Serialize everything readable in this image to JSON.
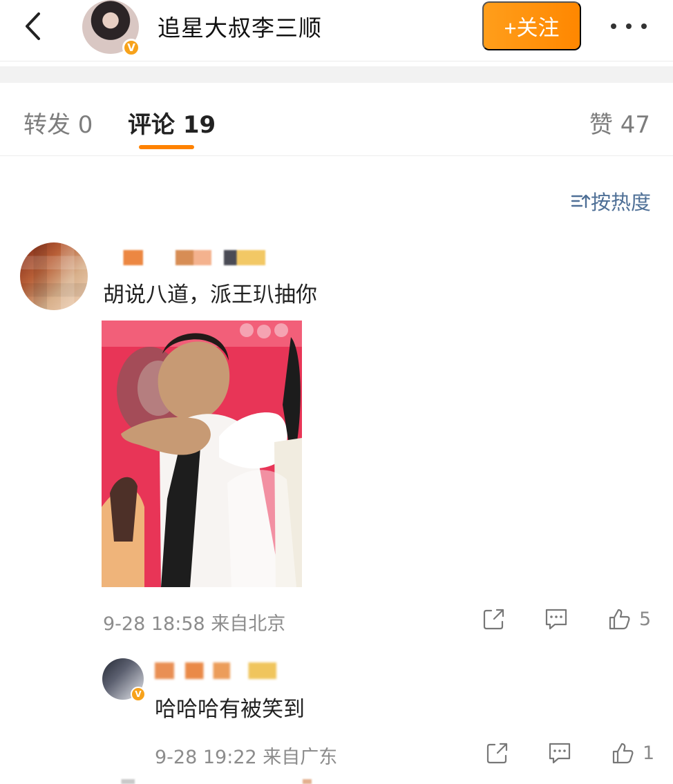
{
  "header": {
    "title": "追星大叔李三顺",
    "follow_label": "+关注",
    "avatar_badge": "V"
  },
  "tabs": {
    "repost": "转发 0",
    "comments": "评论 19",
    "likes": "赞 47"
  },
  "sort": {
    "label": "按热度"
  },
  "comment": {
    "text": "胡说八道，派王玐抽你",
    "meta": "9-28 18:58 来自北京",
    "likes": "5"
  },
  "reply": {
    "text": "哈哈哈有被笑到",
    "meta": "9-28 19:22 来自广东",
    "likes": "1",
    "avatar_badge": "V"
  },
  "colors": {
    "accent": "#ff8200",
    "link_blue": "#4e6f96",
    "muted_text": "#8c8c8c"
  }
}
